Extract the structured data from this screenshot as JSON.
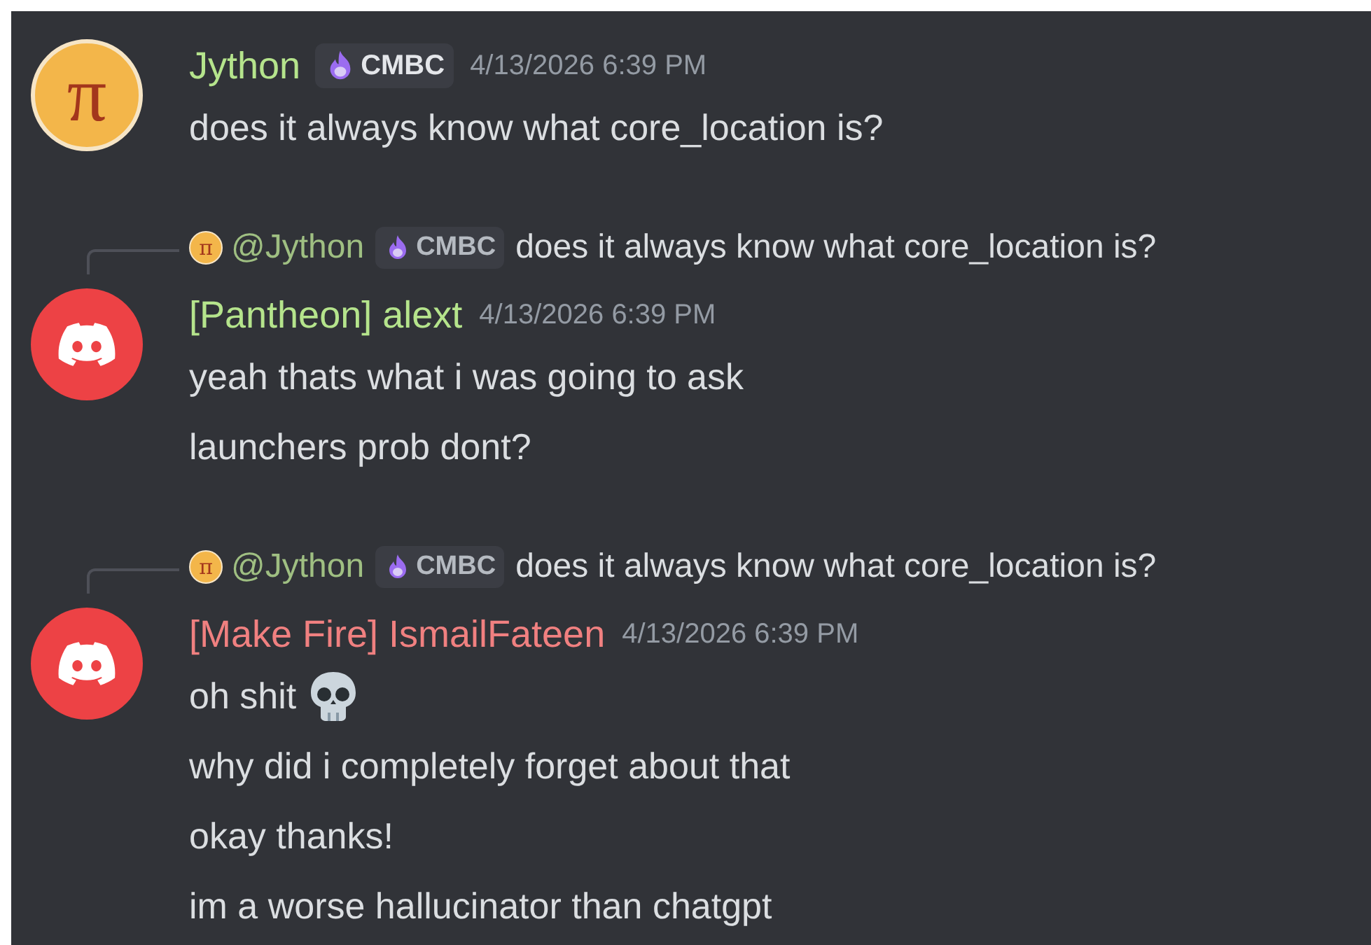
{
  "messages": [
    {
      "avatar": {
        "kind": "pi",
        "glyph": "π"
      },
      "author": "Jython",
      "color": "#b5e48c",
      "badge": "CMBC",
      "timestamp": "4/13/2026 6:39 PM",
      "lines": [
        {
          "text": "does it always know what core_location is?"
        }
      ]
    },
    {
      "reply": {
        "avatar_glyph": "π",
        "author": "@Jython",
        "badge": "CMBC",
        "text": "does it always know what core_location is?"
      },
      "avatar": {
        "kind": "discord"
      },
      "author": "[Pantheon] alext",
      "color": "#b5e48c",
      "timestamp": "4/13/2026 6:39 PM",
      "lines": [
        {
          "text": "yeah thats what i was going to ask"
        },
        {
          "text": "launchers prob dont?"
        }
      ]
    },
    {
      "reply": {
        "avatar_glyph": "π",
        "author": "@Jython",
        "badge": "CMBC",
        "text": "does it always know what core_location is?"
      },
      "avatar": {
        "kind": "discord"
      },
      "author": "[Make Fire] IsmailFateen",
      "color": "#f08080",
      "timestamp": "4/13/2026 6:39 PM",
      "lines": [
        {
          "text": "oh shit",
          "kind": "with-skull"
        },
        {
          "text": "why did i completely forget about that"
        },
        {
          "text": "okay thanks!"
        },
        {
          "text": "im a worse hallucinator than chatgpt"
        }
      ]
    }
  ]
}
